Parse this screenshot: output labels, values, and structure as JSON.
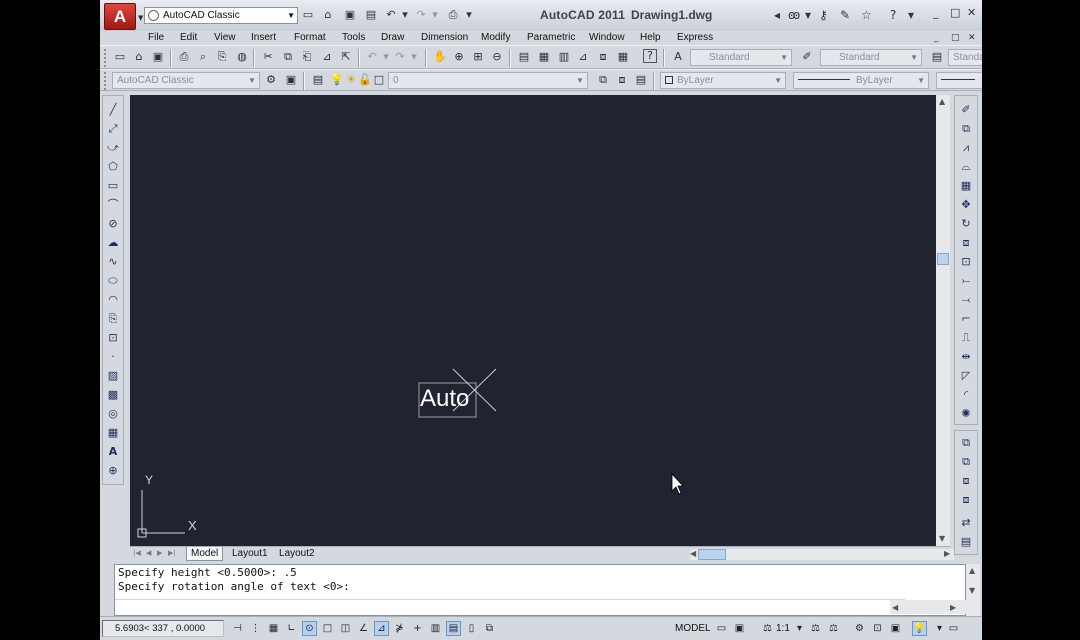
{
  "titlebar": {
    "app_logo": "A",
    "workspace": "AutoCAD Classic",
    "app_name": "AutoCAD 2011",
    "document": "Drawing1.dwg",
    "window_controls": [
      "_",
      "□",
      "✕"
    ]
  },
  "menu": {
    "items": [
      "File",
      "Edit",
      "View",
      "Insert",
      "Format",
      "Tools",
      "Draw",
      "Dimension",
      "Modify",
      "Parametric",
      "Window",
      "Help",
      "Express"
    ],
    "mdi_controls": [
      "_",
      "□",
      "✕"
    ]
  },
  "toolbar2": {
    "text_style": "Standard",
    "dim_style": "Standard",
    "table_style": "Standa"
  },
  "toolbar3": {
    "workspace": "AutoCAD Classic",
    "layer": "0",
    "color": "ByLayer",
    "linetype": "ByLayer"
  },
  "drawing": {
    "text_object": "Auto",
    "ucs_y": "Y",
    "ucs_x": "X",
    "background": "#1f2430"
  },
  "tabs": {
    "items": [
      "Model",
      "Layout1",
      "Layout2"
    ]
  },
  "command": {
    "history": [
      "Specify height <0.5000>: .5",
      "Specify rotation angle of text <0>:"
    ],
    "input": ""
  },
  "status": {
    "coordinates": "5.6903< 337  , 0.0000",
    "space": "MODEL",
    "annotation_scale": "1:1"
  },
  "colors": {
    "accent": "#b7d0ee",
    "logo_red": "#c32a22",
    "canvas": "#1f2430"
  }
}
